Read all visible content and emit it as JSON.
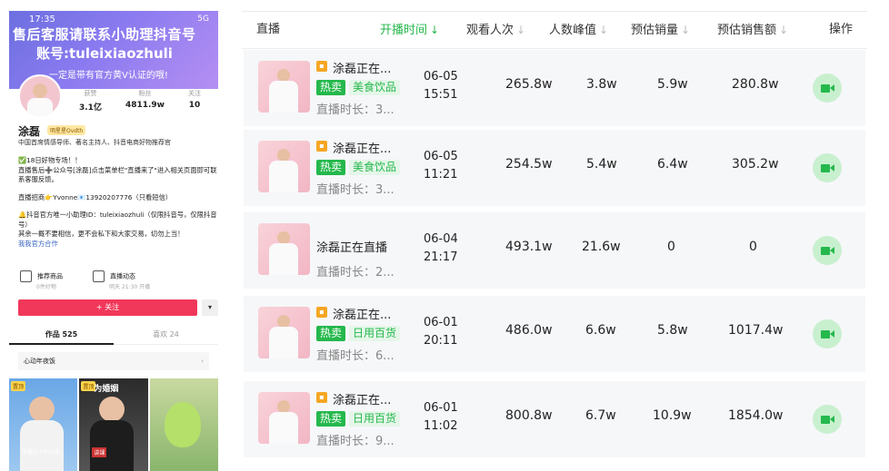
{
  "phone": {
    "time": "17:35",
    "status": "5G",
    "banner_line1": "售后客服请联系小助理抖音号",
    "banner_line2": "账号:tuleixiaozhuli",
    "banner_line3": "一定是带有官方黄V认证的哦!",
    "stats": [
      {
        "label": "获赞",
        "value": "3.1亿"
      },
      {
        "label": "粉丝",
        "value": "4811.9w"
      },
      {
        "label": "关注",
        "value": "10"
      }
    ],
    "name": "涂磊",
    "badge": "明星星Ovdth",
    "desc": "中国首席情感导师、著名主持人、抖音电商好物推荐官",
    "bio": [
      "✅18日好物专场！！",
      "直播售后➕公众号[涂磊]点击菜单栏\"直播来了\"进入相关页面即可联系客服反馈。",
      "",
      "直播招商👉Yvonne📧13920207776（只看短信）",
      "",
      "🔔抖音官方唯一小助理ID：tuleixiaozhuli（仅限抖音号，仅限抖音号）",
      "其余一概不要相信，更不会私下和大家交易，切勿上当！"
    ],
    "bio_link": "我我官方合作",
    "feature1_title": "推荐商品",
    "feature1_sub": "0件好物",
    "feature2_title": "直播动态",
    "feature2_sub": "明天 21:30 开播",
    "follow_label": "+ 关注",
    "more_label": "▾",
    "tab_works": "作品 525",
    "tab_likes": "喜欢 24",
    "collection": "心动年夜饭",
    "collection_chevron": "›",
    "thumbs": [
      {
        "tag": "置顶",
        "caption": "",
        "bottom": "涂磊小人叭大家"
      },
      {
        "tag": "置顶",
        "caption": "为婚姻",
        "bottom": "讲课"
      },
      {
        "tag": "",
        "caption": "",
        "bottom": ""
      }
    ]
  },
  "table": {
    "headers": [
      "直播",
      "开播时间",
      "观看人次",
      "人数峰值",
      "预估销量",
      "预估销售额",
      "操作"
    ],
    "sort_arrow": "↓",
    "rows": [
      {
        "title": "涂磊正在...",
        "hot": "热卖",
        "category": "美食饮品",
        "duration": "直播时长：3...",
        "date": "06-05",
        "time": "15:51",
        "views": "265.8w",
        "peak": "3.8w",
        "sales": "5.9w",
        "revenue": "280.8w"
      },
      {
        "title": "涂磊正在...",
        "hot": "热卖",
        "category": "美食饮品",
        "duration": "直播时长：3...",
        "date": "06-05",
        "time": "11:21",
        "views": "254.5w",
        "peak": "5.4w",
        "sales": "6.4w",
        "revenue": "305.2w"
      },
      {
        "title": "涂磊正在直播",
        "hot": "",
        "category": "",
        "duration": "直播时长：2...",
        "date": "06-04",
        "time": "21:17",
        "views": "493.1w",
        "peak": "21.6w",
        "sales": "0",
        "revenue": "0"
      },
      {
        "title": "涂磊正在...",
        "hot": "热卖",
        "category": "日用百货",
        "duration": "直播时长：6...",
        "date": "06-01",
        "time": "20:11",
        "views": "486.0w",
        "peak": "6.6w",
        "sales": "5.8w",
        "revenue": "1017.4w"
      },
      {
        "title": "涂磊正在...",
        "hot": "热卖",
        "category": "日用百货",
        "duration": "直播时长：9...",
        "date": "06-01",
        "time": "11:02",
        "views": "800.8w",
        "peak": "6.7w",
        "sales": "10.9w",
        "revenue": "1854.0w"
      }
    ],
    "accent_color": "#25b84c"
  }
}
